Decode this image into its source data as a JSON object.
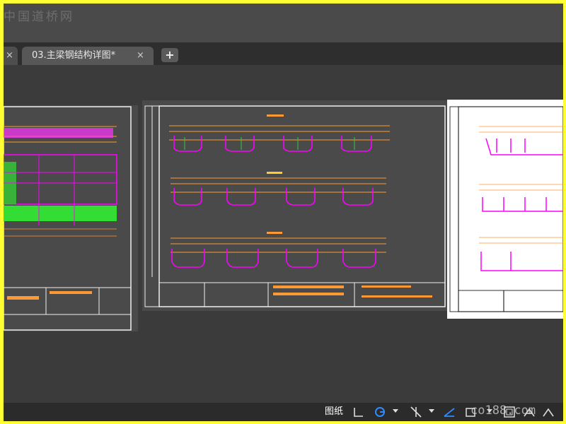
{
  "watermark_top": "中国道桥网",
  "watermark_bottom": "co188.com",
  "tabs": {
    "prev_close": "×",
    "active_label": "03.主梁钢结构详图*",
    "active_close": "×",
    "add": "+"
  },
  "status_bar": {
    "paper_label": "图纸"
  },
  "colors": {
    "cad_frame": "#f0f0f0",
    "cad_orange": "#ff9933",
    "cad_magenta": "#ff00ff",
    "cad_green": "#33cc33",
    "icon_blue": "#2f8cff"
  }
}
